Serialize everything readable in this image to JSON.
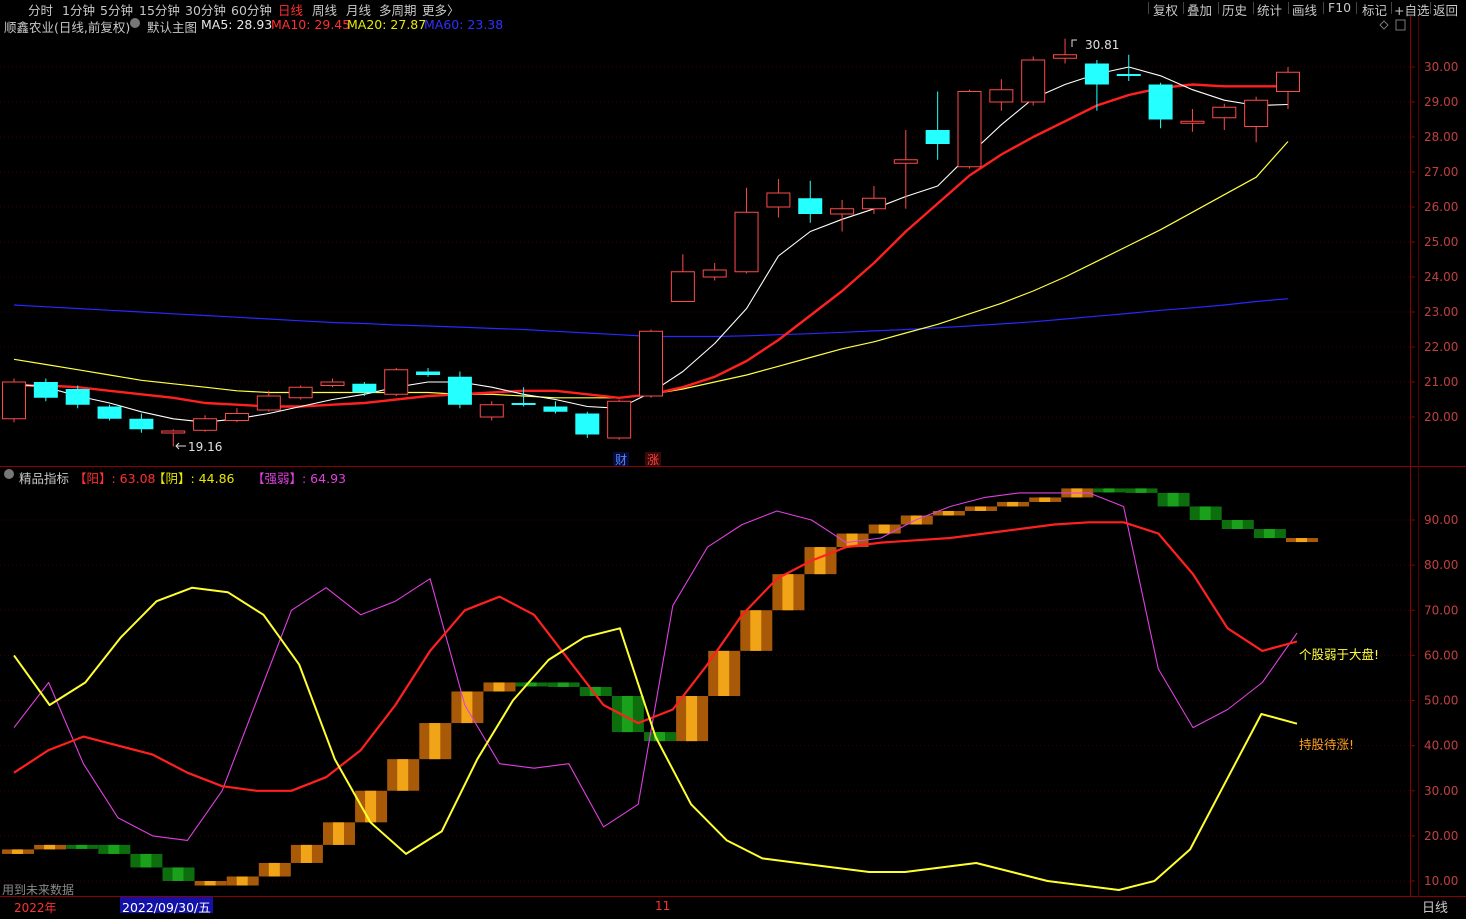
{
  "toolbar": {
    "periods": [
      "分时",
      "1分钟",
      "5分钟",
      "15分钟",
      "30分钟",
      "60分钟",
      "日线",
      "周线",
      "月线",
      "多周期",
      "更多〉"
    ],
    "active_period": "日线",
    "right_buttons": [
      "复权",
      "叠加",
      "历史",
      "统计",
      "画线",
      "F10",
      "标记",
      "+自选",
      "返回"
    ]
  },
  "main_chart": {
    "title": "顺鑫农业(日线,前复权)",
    "indicator_name": "默认主图",
    "ma5": "MA5: 28.93",
    "ma10": "MA10: 29.45",
    "ma20": "MA20: 27.87",
    "ma60": "MA60: 23.38",
    "high_label": "30.81",
    "low_label": "19.16",
    "markers": [
      "财",
      "涨"
    ],
    "y_ticks": [
      "30.00",
      "29.00",
      "28.00",
      "27.00",
      "26.00",
      "25.00",
      "24.00",
      "23.00",
      "22.00",
      "21.00",
      "20.00"
    ]
  },
  "sub_chart": {
    "indicator_name": "精品指标",
    "yang": "【阳】: 63.08",
    "yin": "【阴】: 44.86",
    "qiangruo": "【强弱】: 64.93",
    "note_weak": "个股弱于大盘!",
    "note_hold": "持股待涨!",
    "y_ticks": [
      "90.00",
      "80.00",
      "70.00",
      "60.00",
      "50.00",
      "40.00",
      "30.00",
      "20.00",
      "10.00"
    ]
  },
  "status": {
    "future_data": "用到未来数据",
    "year": "2022年",
    "date": "2022/09/30/五",
    "month": "11",
    "period": "日线"
  },
  "colors": {
    "up": "#ff4a4a",
    "down": "#24ffff",
    "ma5": "#ffffff",
    "ma10": "#ff2020",
    "ma20": "#ffff40",
    "ma60": "#2828ff",
    "magenta": "#e040e0"
  },
  "chart_data": [
    {
      "type": "candlestick",
      "title": "顺鑫农业(日线,前复权)",
      "ylim": [
        19.5,
        30.5
      ],
      "candles": [
        {
          "o": 19.95,
          "c": 21.0,
          "h": 21.1,
          "l": 19.85
        },
        {
          "o": 21.0,
          "c": 20.55,
          "h": 21.1,
          "l": 20.45
        },
        {
          "o": 20.8,
          "c": 20.35,
          "h": 20.9,
          "l": 20.25
        },
        {
          "o": 20.3,
          "c": 19.95,
          "h": 20.35,
          "l": 19.9
        },
        {
          "o": 19.95,
          "c": 19.65,
          "h": 20.1,
          "l": 19.55
        },
        {
          "o": 19.6,
          "c": 19.6,
          "h": 19.65,
          "l": 19.16
        },
        {
          "o": 19.62,
          "c": 19.95,
          "h": 20.05,
          "l": 19.58
        },
        {
          "o": 19.9,
          "c": 20.1,
          "h": 20.25,
          "l": 19.85
        },
        {
          "o": 20.2,
          "c": 20.6,
          "h": 20.75,
          "l": 20.15
        },
        {
          "o": 20.55,
          "c": 20.85,
          "h": 20.9,
          "l": 20.5
        },
        {
          "o": 20.9,
          "c": 21.0,
          "h": 21.1,
          "l": 20.85
        },
        {
          "o": 20.95,
          "c": 20.7,
          "h": 21.0,
          "l": 20.6
        },
        {
          "o": 20.65,
          "c": 21.35,
          "h": 21.4,
          "l": 20.6
        },
        {
          "o": 21.3,
          "c": 21.2,
          "h": 21.4,
          "l": 21.15
        },
        {
          "o": 21.15,
          "c": 20.35,
          "h": 21.3,
          "l": 20.25
        },
        {
          "o": 20.0,
          "c": 20.35,
          "h": 20.45,
          "l": 19.9
        },
        {
          "o": 20.4,
          "c": 20.35,
          "h": 20.85,
          "l": 20.3
        },
        {
          "o": 20.3,
          "c": 20.15,
          "h": 20.45,
          "l": 20.1
        },
        {
          "o": 20.1,
          "c": 19.5,
          "h": 20.15,
          "l": 19.4
        },
        {
          "o": 19.4,
          "c": 20.45,
          "h": 20.5,
          "l": 19.35
        },
        {
          "o": 20.6,
          "c": 22.45,
          "h": 22.5,
          "l": 20.55
        },
        {
          "o": 23.3,
          "c": 24.15,
          "h": 24.65,
          "l": 23.3
        },
        {
          "o": 24.0,
          "c": 24.2,
          "h": 24.4,
          "l": 23.9
        },
        {
          "o": 24.15,
          "c": 25.85,
          "h": 26.55,
          "l": 24.1
        },
        {
          "o": 26.0,
          "c": 26.4,
          "h": 26.8,
          "l": 25.7
        },
        {
          "o": 26.25,
          "c": 25.8,
          "h": 26.75,
          "l": 25.55
        },
        {
          "o": 25.8,
          "c": 25.95,
          "h": 26.2,
          "l": 25.3
        },
        {
          "o": 25.95,
          "c": 26.25,
          "h": 26.6,
          "l": 25.8
        },
        {
          "o": 27.25,
          "c": 27.35,
          "h": 28.2,
          "l": 25.95
        },
        {
          "o": 28.2,
          "c": 27.8,
          "h": 29.3,
          "l": 27.35
        },
        {
          "o": 27.15,
          "c": 29.3,
          "h": 29.35,
          "l": 27.1
        },
        {
          "o": 29.0,
          "c": 29.35,
          "h": 29.65,
          "l": 28.75
        },
        {
          "o": 29.0,
          "c": 30.2,
          "h": 30.3,
          "l": 28.9
        },
        {
          "o": 30.25,
          "c": 30.35,
          "h": 30.81,
          "l": 30.1
        },
        {
          "o": 30.1,
          "c": 29.5,
          "h": 30.2,
          "l": 28.75
        },
        {
          "o": 29.8,
          "c": 29.75,
          "h": 30.35,
          "l": 29.6
        },
        {
          "o": 29.5,
          "c": 28.5,
          "h": 29.55,
          "l": 28.25
        },
        {
          "o": 28.45,
          "c": 28.45,
          "h": 28.8,
          "l": 28.15
        },
        {
          "o": 28.55,
          "c": 28.85,
          "h": 28.95,
          "l": 28.2
        },
        {
          "o": 28.3,
          "c": 29.05,
          "h": 29.15,
          "l": 27.85
        },
        {
          "o": 29.3,
          "c": 29.85,
          "h": 30.0,
          "l": 28.8
        }
      ],
      "ma5": [
        20.95,
        20.85,
        20.6,
        20.4,
        20.15,
        19.95,
        19.85,
        19.95,
        20.1,
        20.3,
        20.5,
        20.65,
        20.85,
        21.0,
        21.0,
        20.85,
        20.65,
        20.5,
        20.3,
        20.25,
        20.7,
        21.3,
        22.1,
        23.1,
        24.6,
        25.3,
        25.65,
        25.95,
        26.3,
        26.6,
        27.5,
        28.35,
        29.1,
        29.5,
        29.8,
        30.0,
        29.75,
        29.35,
        29.05,
        28.9,
        28.93
      ],
      "ma10": [
        20.9,
        20.9,
        20.85,
        20.75,
        20.65,
        20.55,
        20.4,
        20.35,
        20.3,
        20.3,
        20.35,
        20.4,
        20.5,
        20.6,
        20.65,
        20.7,
        20.75,
        20.75,
        20.65,
        20.55,
        20.65,
        20.85,
        21.15,
        21.6,
        22.2,
        22.9,
        23.6,
        24.4,
        25.3,
        26.1,
        26.9,
        27.5,
        28.0,
        28.45,
        28.9,
        29.2,
        29.4,
        29.5,
        29.45,
        29.45,
        29.45
      ],
      "ma20": [
        21.65,
        21.5,
        21.35,
        21.2,
        21.05,
        20.95,
        20.85,
        20.75,
        20.7,
        20.7,
        20.7,
        20.7,
        20.7,
        20.7,
        20.65,
        20.65,
        20.6,
        20.55,
        20.55,
        20.55,
        20.65,
        20.8,
        21.0,
        21.2,
        21.45,
        21.7,
        21.95,
        22.15,
        22.4,
        22.65,
        22.95,
        23.25,
        23.6,
        24.0,
        24.45,
        24.9,
        25.35,
        25.85,
        26.35,
        26.85,
        27.87
      ],
      "ma60": [
        23.2,
        23.15,
        23.1,
        23.05,
        23.0,
        22.95,
        22.9,
        22.85,
        22.8,
        22.75,
        22.7,
        22.67,
        22.63,
        22.6,
        22.57,
        22.53,
        22.5,
        22.45,
        22.4,
        22.35,
        22.3,
        22.3,
        22.3,
        22.32,
        22.35,
        22.38,
        22.42,
        22.46,
        22.5,
        22.55,
        22.6,
        22.66,
        22.72,
        22.8,
        22.88,
        22.96,
        23.05,
        23.12,
        23.2,
        23.3,
        23.38
      ]
    },
    {
      "type": "line",
      "title": "精品指标",
      "ylim": [
        8,
        100
      ],
      "series": [
        {
          "name": "【阳】",
          "values": [
            34,
            39,
            42,
            40,
            38,
            34,
            31,
            30,
            30,
            33,
            39,
            49,
            61,
            70,
            73,
            69,
            59,
            49,
            45,
            48,
            58,
            69,
            77,
            81,
            84,
            85,
            85.5,
            86,
            87,
            88,
            89,
            89.5,
            89.5,
            87,
            78,
            66,
            61,
            63.08
          ]
        },
        {
          "name": "【阴】",
          "values": [
            60,
            49,
            54,
            64,
            72,
            75,
            74,
            69,
            58,
            37,
            23,
            16,
            21,
            37,
            50,
            59,
            64,
            66,
            42,
            27,
            19,
            15,
            14,
            13,
            12,
            12,
            13,
            14,
            12,
            10,
            9,
            8,
            10,
            17,
            32,
            47,
            44.86
          ]
        },
        {
          "name": "【强弱】",
          "values": [
            44,
            54,
            36,
            24,
            20,
            19,
            30,
            50,
            70,
            75,
            69,
            72,
            77,
            49,
            36,
            35,
            36,
            22,
            27,
            71,
            84,
            89,
            92,
            90,
            85,
            86,
            90,
            93,
            95,
            96,
            96,
            96,
            93,
            57,
            44,
            48,
            54,
            64.93
          ]
        }
      ],
      "blocks": [
        {
          "v": 17,
          "up": true
        },
        {
          "v": 18,
          "up": true
        },
        {
          "v": 18,
          "up": false
        },
        {
          "v": 16,
          "up": false
        },
        {
          "v": 13,
          "up": false
        },
        {
          "v": 10,
          "up": false
        },
        {
          "v": 9,
          "up": true
        },
        {
          "v": 11,
          "up": true
        },
        {
          "v": 14,
          "up": true
        },
        {
          "v": 18,
          "up": true
        },
        {
          "v": 23,
          "up": true
        },
        {
          "v": 30,
          "up": true
        },
        {
          "v": 37,
          "up": true
        },
        {
          "v": 45,
          "up": true
        },
        {
          "v": 52,
          "up": true
        },
        {
          "v": 54,
          "up": true
        },
        {
          "v": 54,
          "up": false
        },
        {
          "v": 53,
          "up": false
        },
        {
          "v": 51,
          "up": false
        },
        {
          "v": 43,
          "up": false
        },
        {
          "v": 41,
          "up": false
        },
        {
          "v": 51,
          "up": true
        },
        {
          "v": 61,
          "up": true
        },
        {
          "v": 70,
          "up": true
        },
        {
          "v": 78,
          "up": true
        },
        {
          "v": 84,
          "up": true
        },
        {
          "v": 87,
          "up": true
        },
        {
          "v": 89,
          "up": true
        },
        {
          "v": 91,
          "up": true
        },
        {
          "v": 92,
          "up": true
        },
        {
          "v": 93,
          "up": true
        },
        {
          "v": 94,
          "up": true
        },
        {
          "v": 95,
          "up": true
        },
        {
          "v": 97,
          "up": true
        },
        {
          "v": 97,
          "up": false
        },
        {
          "v": 96,
          "up": false
        },
        {
          "v": 93,
          "up": false
        },
        {
          "v": 90,
          "up": false
        },
        {
          "v": 88,
          "up": false
        },
        {
          "v": 86,
          "up": false
        },
        {
          "v": 86,
          "up": true
        }
      ]
    }
  ]
}
